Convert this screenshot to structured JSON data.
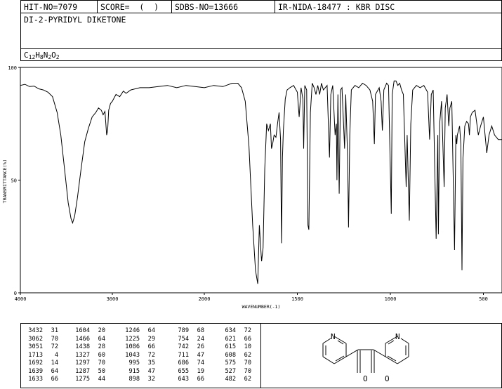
{
  "header": {
    "hit_no": "HIT-NO=7079",
    "score": "SCORE=  (  )",
    "sdbs_no": "SDBS-NO=13666",
    "ir_source": "IR-NIDA-18477 : KBR DISC"
  },
  "compound_name": "DI-2-PYRIDYL DIKETONE",
  "formula": {
    "parts": [
      {
        "t": "C",
        "sub": false
      },
      {
        "t": "12",
        "sub": true
      },
      {
        "t": "H",
        "sub": false
      },
      {
        "t": "8",
        "sub": true
      },
      {
        "t": "N",
        "sub": false
      },
      {
        "t": "2",
        "sub": true
      },
      {
        "t": "O",
        "sub": false
      },
      {
        "t": "2",
        "sub": true
      }
    ]
  },
  "chart_data": {
    "type": "line",
    "xlabel": "WAVENUMBER(-1)",
    "ylabel": "TRANSMITTANCE(%)",
    "xlim": [
      4000,
      400
    ],
    "ylim": [
      0,
      100
    ],
    "x_ticks": [
      "4000",
      "3000",
      "2000",
      "1500",
      "1000",
      "500"
    ],
    "y_ticks": [
      "0",
      "50",
      "100"
    ],
    "grid": false,
    "series": [
      {
        "name": "",
        "points": [
          [
            4000,
            92
          ],
          [
            3950,
            92.5
          ],
          [
            3900,
            91.5
          ],
          [
            3850,
            91.7
          ],
          [
            3800,
            90.5
          ],
          [
            3750,
            90
          ],
          [
            3700,
            89
          ],
          [
            3650,
            87
          ],
          [
            3600,
            80
          ],
          [
            3560,
            70
          ],
          [
            3520,
            55
          ],
          [
            3480,
            40
          ],
          [
            3450,
            33
          ],
          [
            3432,
            31
          ],
          [
            3410,
            34
          ],
          [
            3380,
            42
          ],
          [
            3340,
            55
          ],
          [
            3300,
            67
          ],
          [
            3260,
            73
          ],
          [
            3220,
            78
          ],
          [
            3180,
            80
          ],
          [
            3150,
            82
          ],
          [
            3120,
            81
          ],
          [
            3100,
            79
          ],
          [
            3080,
            80.5
          ],
          [
            3062,
            70
          ],
          [
            3051,
            72
          ],
          [
            3040,
            81
          ],
          [
            3020,
            84
          ],
          [
            3000,
            85
          ],
          [
            2960,
            88
          ],
          [
            2920,
            87
          ],
          [
            2880,
            89.5
          ],
          [
            2850,
            88.5
          ],
          [
            2800,
            90
          ],
          [
            2700,
            91
          ],
          [
            2600,
            91
          ],
          [
            2500,
            91.5
          ],
          [
            2400,
            92
          ],
          [
            2300,
            91
          ],
          [
            2200,
            92
          ],
          [
            2100,
            91.5
          ],
          [
            2000,
            91
          ],
          [
            1950,
            92
          ],
          [
            1900,
            91.5
          ],
          [
            1850,
            93
          ],
          [
            1820,
            93
          ],
          [
            1800,
            91
          ],
          [
            1780,
            85
          ],
          [
            1760,
            65
          ],
          [
            1740,
            30
          ],
          [
            1725,
            10
          ],
          [
            1713,
            4
          ],
          [
            1704,
            30
          ],
          [
            1697,
            20
          ],
          [
            1692,
            14
          ],
          [
            1684,
            20
          ],
          [
            1675,
            55
          ],
          [
            1665,
            75
          ],
          [
            1655,
            72
          ],
          [
            1645,
            75
          ],
          [
            1639,
            64
          ],
          [
            1633,
            66
          ],
          [
            1625,
            70
          ],
          [
            1615,
            69
          ],
          [
            1605,
            76
          ],
          [
            1598,
            80
          ],
          [
            1590,
            68
          ],
          [
            1585,
            22
          ],
          [
            1580,
            60
          ],
          [
            1575,
            72
          ],
          [
            1565,
            86
          ],
          [
            1555,
            90
          ],
          [
            1540,
            91
          ],
          [
            1520,
            92
          ],
          [
            1500,
            89
          ],
          [
            1490,
            78
          ],
          [
            1480,
            91
          ],
          [
            1470,
            86
          ],
          [
            1466,
            64
          ],
          [
            1460,
            92
          ],
          [
            1450,
            90
          ],
          [
            1443,
            30
          ],
          [
            1438,
            28
          ],
          [
            1430,
            80
          ],
          [
            1420,
            93
          ],
          [
            1410,
            91
          ],
          [
            1400,
            88
          ],
          [
            1390,
            92
          ],
          [
            1380,
            88
          ],
          [
            1370,
            93
          ],
          [
            1360,
            90
          ],
          [
            1340,
            92
          ],
          [
            1327,
            60
          ],
          [
            1320,
            88
          ],
          [
            1310,
            92
          ],
          [
            1297,
            70
          ],
          [
            1290,
            75
          ],
          [
            1287,
            50
          ],
          [
            1282,
            88
          ],
          [
            1275,
            44
          ],
          [
            1268,
            90
          ],
          [
            1260,
            91
          ],
          [
            1246,
            64
          ],
          [
            1240,
            88
          ],
          [
            1230,
            60
          ],
          [
            1225,
            29
          ],
          [
            1218,
            70
          ],
          [
            1210,
            90
          ],
          [
            1190,
            92
          ],
          [
            1170,
            91
          ],
          [
            1150,
            93
          ],
          [
            1130,
            92
          ],
          [
            1110,
            90
          ],
          [
            1095,
            85
          ],
          [
            1086,
            66
          ],
          [
            1080,
            88
          ],
          [
            1060,
            91
          ],
          [
            1050,
            85
          ],
          [
            1043,
            72
          ],
          [
            1035,
            90
          ],
          [
            1020,
            93
          ],
          [
            1010,
            92
          ],
          [
            995,
            35
          ],
          [
            990,
            88
          ],
          [
            980,
            94
          ],
          [
            970,
            94
          ],
          [
            960,
            92
          ],
          [
            950,
            93
          ],
          [
            940,
            90
          ],
          [
            930,
            88
          ],
          [
            915,
            47
          ],
          [
            910,
            70
          ],
          [
            898,
            32
          ],
          [
            890,
            75
          ],
          [
            880,
            90
          ],
          [
            860,
            92
          ],
          [
            840,
            91
          ],
          [
            820,
            92
          ],
          [
            800,
            89
          ],
          [
            789,
            68
          ],
          [
            780,
            88
          ],
          [
            770,
            90
          ],
          [
            754,
            24
          ],
          [
            745,
            70
          ],
          [
            742,
            26
          ],
          [
            735,
            75
          ],
          [
            725,
            85
          ],
          [
            711,
            47
          ],
          [
            705,
            82
          ],
          [
            695,
            88
          ],
          [
            686,
            74
          ],
          [
            680,
            82
          ],
          [
            670,
            85
          ],
          [
            655,
            19
          ],
          [
            648,
            70
          ],
          [
            643,
            66
          ],
          [
            640,
            70
          ],
          [
            634,
            72
          ],
          [
            628,
            74
          ],
          [
            621,
            66
          ],
          [
            615,
            10
          ],
          [
            610,
            60
          ],
          [
            608,
            62
          ],
          [
            600,
            74
          ],
          [
            590,
            76
          ],
          [
            580,
            75
          ],
          [
            575,
            70
          ],
          [
            570,
            78
          ],
          [
            560,
            80
          ],
          [
            545,
            81
          ],
          [
            527,
            70
          ],
          [
            515,
            74
          ],
          [
            500,
            78
          ],
          [
            482,
            62
          ],
          [
            470,
            70
          ],
          [
            455,
            74
          ],
          [
            440,
            70
          ],
          [
            420,
            68
          ],
          [
            400,
            68
          ]
        ]
      }
    ]
  },
  "peak_table": {
    "columns": [
      [
        [
          "3432",
          "31"
        ],
        [
          "3062",
          "70"
        ],
        [
          "3051",
          "72"
        ],
        [
          "1713",
          "4"
        ],
        [
          "1692",
          "14"
        ],
        [
          "1639",
          "64"
        ],
        [
          "1633",
          "66"
        ]
      ],
      [
        [
          "1604",
          "20"
        ],
        [
          "1466",
          "64"
        ],
        [
          "1438",
          "28"
        ],
        [
          "1327",
          "60"
        ],
        [
          "1297",
          "70"
        ],
        [
          "1287",
          "50"
        ],
        [
          "1275",
          "44"
        ]
      ],
      [
        [
          "1246",
          "64"
        ],
        [
          "1225",
          "29"
        ],
        [
          "1086",
          "66"
        ],
        [
          "1043",
          "72"
        ],
        [
          "995",
          "35"
        ],
        [
          "915",
          "47"
        ],
        [
          "898",
          "32"
        ]
      ],
      [
        [
          "789",
          "68"
        ],
        [
          "754",
          "24"
        ],
        [
          "742",
          "26"
        ],
        [
          "711",
          "47"
        ],
        [
          "686",
          "74"
        ],
        [
          "655",
          "19"
        ],
        [
          "643",
          "66"
        ]
      ],
      [
        [
          "634",
          "72"
        ],
        [
          "621",
          "66"
        ],
        [
          "615",
          "10"
        ],
        [
          "608",
          "62"
        ],
        [
          "575",
          "70"
        ],
        [
          "527",
          "70"
        ],
        [
          "482",
          "62"
        ]
      ]
    ]
  },
  "structure": {
    "atoms": {
      "n_left": "N",
      "n_right": "N",
      "o_left": "O",
      "o_right": "O"
    }
  }
}
